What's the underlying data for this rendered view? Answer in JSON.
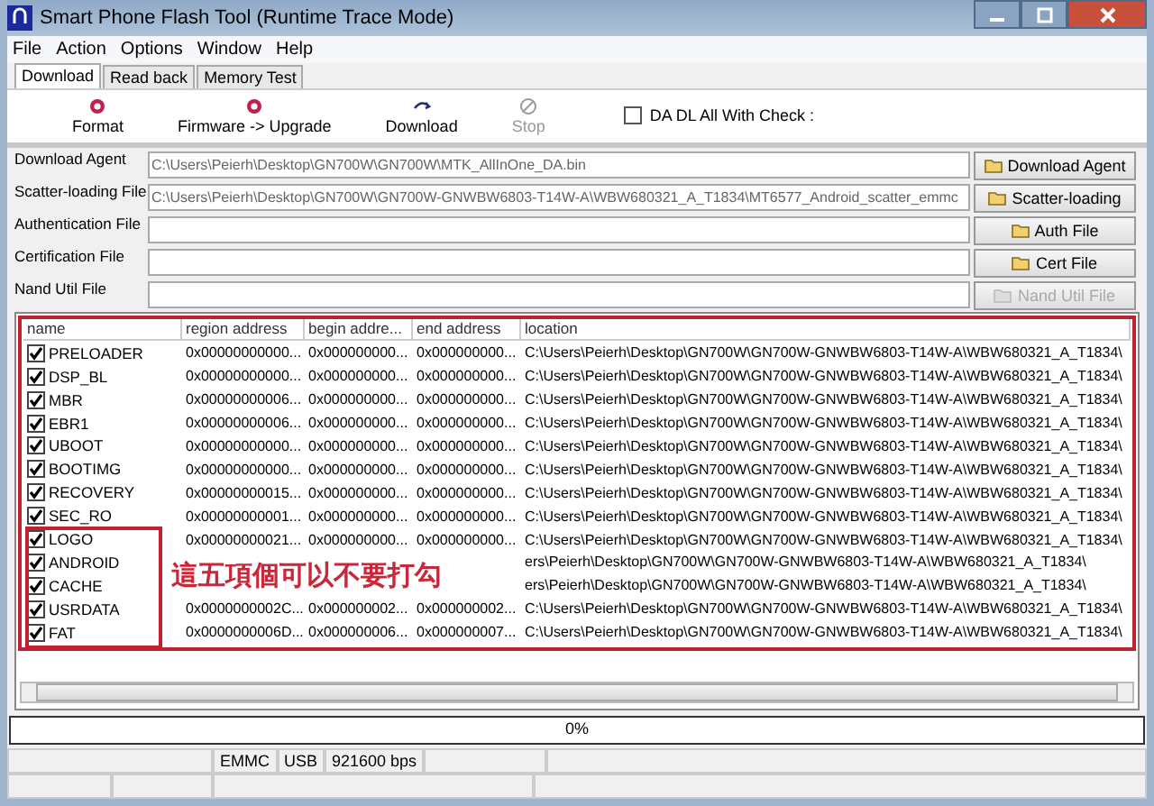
{
  "window": {
    "title": "Smart Phone Flash Tool (Runtime Trace Mode)"
  },
  "menu": [
    "File",
    "Action",
    "Options",
    "Window",
    "Help"
  ],
  "tabs": [
    {
      "label": "Download",
      "selected": true
    },
    {
      "label": "Read back",
      "selected": false
    },
    {
      "label": "Memory Test",
      "selected": false
    }
  ],
  "toolbar": [
    {
      "kind": "format",
      "label": "Format",
      "disabled": false
    },
    {
      "kind": "upgrade",
      "label": "Firmware -> Upgrade",
      "disabled": false
    },
    {
      "kind": "download",
      "label": "Download",
      "disabled": false
    },
    {
      "kind": "stop",
      "label": "Stop",
      "disabled": true
    }
  ],
  "da_check": {
    "label": "DA DL All With Check :",
    "checked": false
  },
  "files": [
    {
      "label": "Download Agent",
      "value": "C:\\Users\\Peierh\\Desktop\\GN700W\\GN700W\\MTK_AllInOne_DA.bin",
      "button": "Download Agent",
      "disabled": false
    },
    {
      "label": "Scatter-loading File",
      "value": "C:\\Users\\Peierh\\Desktop\\GN700W\\GN700W-GNWBW6803-T14W-A\\WBW680321_A_T1834\\MT6577_Android_scatter_emmc",
      "button": "Scatter-loading",
      "disabled": false
    },
    {
      "label": "Authentication File",
      "button": "Auth File",
      "disabled": false
    },
    {
      "label": "Certification File",
      "button": "Cert File",
      "disabled": false
    },
    {
      "label": "Nand Util File",
      "button": "Nand Util File",
      "disabled": true
    }
  ],
  "table": {
    "columns": [
      "name",
      "region address",
      "begin addre...",
      "end address",
      "location"
    ],
    "rows": [
      {
        "name": "PRELOADER",
        "checked": true,
        "region": "0x00000000000...",
        "begin": "0x000000000...",
        "end": "0x000000000...",
        "location": "C:\\Users\\Peierh\\Desktop\\GN700W\\GN700W-GNWBW6803-T14W-A\\WBW680321_A_T1834\\"
      },
      {
        "name": "DSP_BL",
        "checked": true,
        "region": "0x00000000000...",
        "begin": "0x000000000...",
        "end": "0x000000000...",
        "location": "C:\\Users\\Peierh\\Desktop\\GN700W\\GN700W-GNWBW6803-T14W-A\\WBW680321_A_T1834\\"
      },
      {
        "name": "MBR",
        "checked": true,
        "region": "0x00000000006...",
        "begin": "0x000000000...",
        "end": "0x000000000...",
        "location": "C:\\Users\\Peierh\\Desktop\\GN700W\\GN700W-GNWBW6803-T14W-A\\WBW680321_A_T1834\\"
      },
      {
        "name": "EBR1",
        "checked": true,
        "region": "0x00000000006...",
        "begin": "0x000000000...",
        "end": "0x000000000...",
        "location": "C:\\Users\\Peierh\\Desktop\\GN700W\\GN700W-GNWBW6803-T14W-A\\WBW680321_A_T1834\\"
      },
      {
        "name": "UBOOT",
        "checked": true,
        "region": "0x00000000000...",
        "begin": "0x000000000...",
        "end": "0x000000000...",
        "location": "C:\\Users\\Peierh\\Desktop\\GN700W\\GN700W-GNWBW6803-T14W-A\\WBW680321_A_T1834\\"
      },
      {
        "name": "BOOTIMG",
        "checked": true,
        "region": "0x00000000000...",
        "begin": "0x000000000...",
        "end": "0x000000000...",
        "location": "C:\\Users\\Peierh\\Desktop\\GN700W\\GN700W-GNWBW6803-T14W-A\\WBW680321_A_T1834\\"
      },
      {
        "name": "RECOVERY",
        "checked": true,
        "region": "0x00000000015...",
        "begin": "0x000000000...",
        "end": "0x000000000...",
        "location": "C:\\Users\\Peierh\\Desktop\\GN700W\\GN700W-GNWBW6803-T14W-A\\WBW680321_A_T1834\\"
      },
      {
        "name": "SEC_RO",
        "checked": true,
        "region": "0x00000000001...",
        "begin": "0x000000000...",
        "end": "0x000000000...",
        "location": "C:\\Users\\Peierh\\Desktop\\GN700W\\GN700W-GNWBW6803-T14W-A\\WBW680321_A_T1834\\"
      },
      {
        "name": "LOGO",
        "checked": true,
        "region": "0x00000000021...",
        "begin": "0x000000000...",
        "end": "0x000000000...",
        "location": "C:\\Users\\Peierh\\Desktop\\GN700W\\GN700W-GNWBW6803-T14W-A\\WBW680321_A_T1834\\"
      },
      {
        "name": "ANDROID",
        "checked": true,
        "location": "ers\\Peierh\\Desktop\\GN700W\\GN700W-GNWBW6803-T14W-A\\WBW680321_A_T1834\\"
      },
      {
        "name": "CACHE",
        "checked": true,
        "location": "ers\\Peierh\\Desktop\\GN700W\\GN700W-GNWBW6803-T14W-A\\WBW680321_A_T1834\\"
      },
      {
        "name": "USRDATA",
        "checked": true,
        "region": "0x0000000002C...",
        "begin": "0x000000002...",
        "end": "0x000000002...",
        "location": "C:\\Users\\Peierh\\Desktop\\GN700W\\GN700W-GNWBW6803-T14W-A\\WBW680321_A_T1834\\"
      },
      {
        "name": "FAT",
        "checked": true,
        "region": "0x0000000006D...",
        "begin": "0x000000006...",
        "end": "0x000000007...",
        "location": "C:\\Users\\Peierh\\Desktop\\GN700W\\GN700W-GNWBW6803-T14W-A\\WBW680321_A_T1834\\"
      }
    ]
  },
  "annotation": {
    "text": "這五項個可以不要打勾"
  },
  "progress": {
    "level": 0,
    "reading": "0%"
  },
  "status_bar": [
    "EMMC",
    "USB",
    "921600 bps"
  ]
}
